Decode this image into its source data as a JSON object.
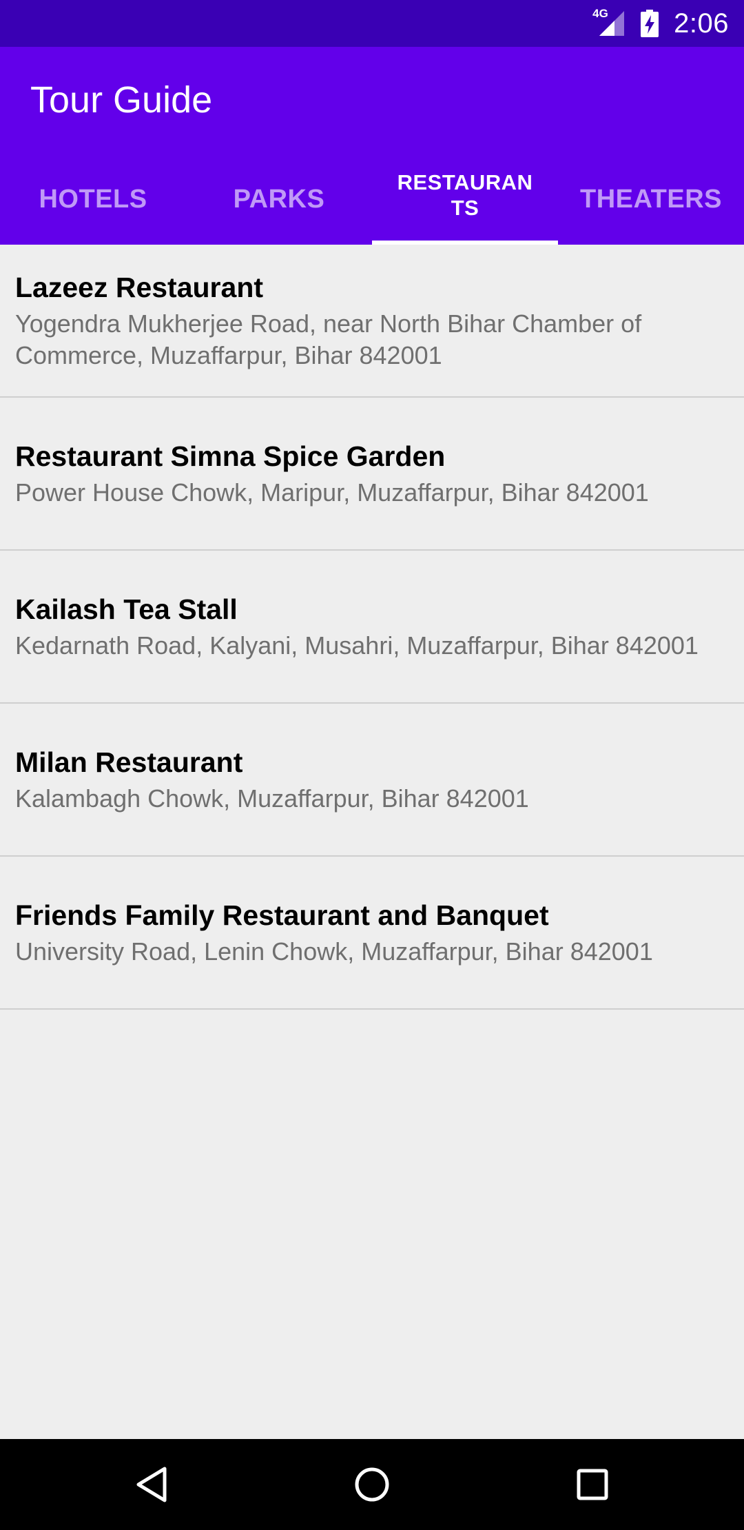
{
  "status_bar": {
    "network": "4G",
    "time": "2:06",
    "icons": [
      "signal-icon",
      "battery-charging-icon"
    ]
  },
  "app_bar": {
    "title": "Tour Guide"
  },
  "colors": {
    "primary": "#6200ea",
    "primary_dark": "#3a00b4",
    "background": "#eeeeee"
  },
  "tabs": [
    {
      "label": "HOTELS",
      "selected": false
    },
    {
      "label": "PARKS",
      "selected": false
    },
    {
      "label": "RESTAURANTS",
      "selected": true
    },
    {
      "label": "THEATERS",
      "selected": false
    }
  ],
  "restaurants": [
    {
      "name": "Lazeez Restaurant",
      "address": "Yogendra Mukherjee Road, near North Bihar Chamber of Commerce, Muzaffarpur, Bihar 842001"
    },
    {
      "name": "Restaurant Simna Spice Garden",
      "address": "Power House Chowk, Maripur, Muzaffarpur, Bihar 842001"
    },
    {
      "name": "Kailash Tea Stall",
      "address": "Kedarnath Road, Kalyani, Musahri, Muzaffarpur, Bihar 842001"
    },
    {
      "name": "Milan Restaurant",
      "address": "Kalambagh Chowk, Muzaffarpur, Bihar 842001"
    },
    {
      "name": "Friends Family Restaurant and Banquet",
      "address": "University Road, Lenin Chowk, Muzaffarpur, Bihar 842001"
    }
  ],
  "nav_bar": {
    "buttons": [
      "back-icon",
      "home-icon",
      "recents-icon"
    ]
  }
}
